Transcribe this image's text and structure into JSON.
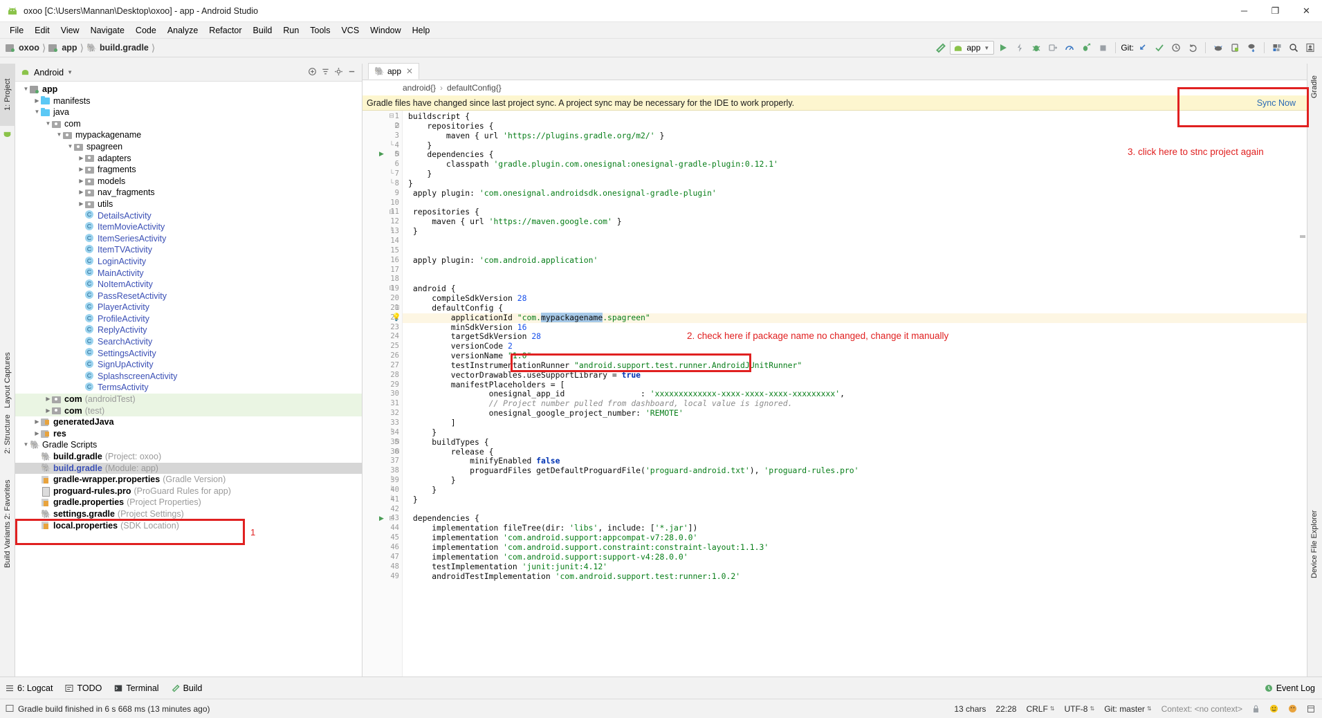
{
  "window": {
    "title": "oxoo [C:\\Users\\Mannan\\Desktop\\oxoo] - app - Android Studio",
    "minimize": "─",
    "maximize": "❐",
    "close": "✕"
  },
  "menubar": [
    "File",
    "Edit",
    "View",
    "Navigate",
    "Code",
    "Analyze",
    "Refactor",
    "Build",
    "Run",
    "Tools",
    "VCS",
    "Window",
    "Help"
  ],
  "navbar": {
    "crumbs": [
      "oxoo",
      "app",
      "build.gradle"
    ],
    "run_config": "app",
    "git_label": "Git:"
  },
  "project_panel": {
    "title": "Android",
    "tree": [
      {
        "depth": 0,
        "twisty": "down",
        "icon": "module",
        "label": "app",
        "bold": true
      },
      {
        "depth": 1,
        "twisty": "right",
        "icon": "folder",
        "label": "manifests"
      },
      {
        "depth": 1,
        "twisty": "down",
        "icon": "folder",
        "label": "java"
      },
      {
        "depth": 2,
        "twisty": "down",
        "icon": "package",
        "label": "com"
      },
      {
        "depth": 3,
        "twisty": "down",
        "icon": "package",
        "label": "mypackagename"
      },
      {
        "depth": 4,
        "twisty": "down",
        "icon": "package",
        "label": "spagreen"
      },
      {
        "depth": 5,
        "twisty": "right",
        "icon": "package",
        "label": "adapters"
      },
      {
        "depth": 5,
        "twisty": "right",
        "icon": "package",
        "label": "fragments"
      },
      {
        "depth": 5,
        "twisty": "right",
        "icon": "package",
        "label": "models"
      },
      {
        "depth": 5,
        "twisty": "right",
        "icon": "package",
        "label": "nav_fragments"
      },
      {
        "depth": 5,
        "twisty": "right",
        "icon": "package",
        "label": "utils"
      },
      {
        "depth": 5,
        "twisty": "none",
        "icon": "class",
        "label": "DetailsActivity",
        "blue": true
      },
      {
        "depth": 5,
        "twisty": "none",
        "icon": "class",
        "label": "ItemMovieActivity",
        "blue": true
      },
      {
        "depth": 5,
        "twisty": "none",
        "icon": "class",
        "label": "ItemSeriesActivity",
        "blue": true
      },
      {
        "depth": 5,
        "twisty": "none",
        "icon": "class",
        "label": "ItemTVActivity",
        "blue": true
      },
      {
        "depth": 5,
        "twisty": "none",
        "icon": "class",
        "label": "LoginActivity",
        "blue": true
      },
      {
        "depth": 5,
        "twisty": "none",
        "icon": "class",
        "label": "MainActivity",
        "blue": true
      },
      {
        "depth": 5,
        "twisty": "none",
        "icon": "class",
        "label": "NoItemActivity",
        "blue": true
      },
      {
        "depth": 5,
        "twisty": "none",
        "icon": "class",
        "label": "PassResetActivity",
        "blue": true
      },
      {
        "depth": 5,
        "twisty": "none",
        "icon": "class",
        "label": "PlayerActivity",
        "blue": true
      },
      {
        "depth": 5,
        "twisty": "none",
        "icon": "class",
        "label": "ProfileActivity",
        "blue": true
      },
      {
        "depth": 5,
        "twisty": "none",
        "icon": "class",
        "label": "ReplyActivity",
        "blue": true
      },
      {
        "depth": 5,
        "twisty": "none",
        "icon": "class",
        "label": "SearchActivity",
        "blue": true
      },
      {
        "depth": 5,
        "twisty": "none",
        "icon": "class",
        "label": "SettingsActivity",
        "blue": true
      },
      {
        "depth": 5,
        "twisty": "none",
        "icon": "class",
        "label": "SignUpActivity",
        "blue": true
      },
      {
        "depth": 5,
        "twisty": "none",
        "icon": "class",
        "label": "SplashscreenActivity",
        "blue": true
      },
      {
        "depth": 5,
        "twisty": "none",
        "icon": "class",
        "label": "TermsActivity",
        "blue": true
      },
      {
        "depth": 2,
        "twisty": "right",
        "icon": "package",
        "label": "com",
        "sub": "(androidTest)",
        "bold": true,
        "testrow": true
      },
      {
        "depth": 2,
        "twisty": "right",
        "icon": "package",
        "label": "com",
        "sub": "(test)",
        "bold": true,
        "testrow": true
      },
      {
        "depth": 1,
        "twisty": "right",
        "icon": "generated",
        "label": "generatedJava",
        "bold": true
      },
      {
        "depth": 1,
        "twisty": "right",
        "icon": "res",
        "label": "res",
        "bold": true
      },
      {
        "depth": 0,
        "twisty": "down",
        "icon": "gradle",
        "label": "Gradle Scripts",
        "bold": false
      },
      {
        "depth": 1,
        "twisty": "none",
        "icon": "gradle",
        "label": "build.gradle",
        "sub": "(Project: oxoo)",
        "bold": true
      },
      {
        "depth": 1,
        "twisty": "none",
        "icon": "gradle",
        "label": "build.gradle",
        "sub": "(Module: app)",
        "bold": true,
        "blue": true,
        "selected": true
      },
      {
        "depth": 1,
        "twisty": "none",
        "icon": "props",
        "label": "gradle-wrapper.properties",
        "sub": "(Gradle Version)",
        "bold": true
      },
      {
        "depth": 1,
        "twisty": "none",
        "icon": "doc",
        "label": "proguard-rules.pro",
        "sub": "(ProGuard Rules for app)",
        "bold": true
      },
      {
        "depth": 1,
        "twisty": "none",
        "icon": "props",
        "label": "gradle.properties",
        "sub": "(Project Properties)",
        "bold": true
      },
      {
        "depth": 1,
        "twisty": "none",
        "icon": "gradle",
        "label": "settings.gradle",
        "sub": "(Project Settings)",
        "bold": true
      },
      {
        "depth": 1,
        "twisty": "none",
        "icon": "props",
        "label": "local.properties",
        "sub": "(SDK Location)",
        "bold": true
      }
    ]
  },
  "left_rail": [
    {
      "label": "1: Project",
      "selected": true
    },
    {
      "label": "Layout Captures",
      "selected": false
    },
    {
      "label": "2: Structure",
      "selected": false
    },
    {
      "label": "2: Favorites",
      "selected": false
    },
    {
      "label": "Build Variants",
      "selected": false
    }
  ],
  "right_rail": [
    {
      "label": "Gradle"
    },
    {
      "label": "Device File Explorer"
    }
  ],
  "editor": {
    "tab_label": "app",
    "tab_close": "✕",
    "breadcrumbs": [
      "android{}",
      "defaultConfig{}"
    ],
    "notification": "Gradle files have changed since last project sync. A project sync may be necessary for the IDE to work properly.",
    "sync_now": "Sync Now",
    "lines": [
      {
        "n": 1,
        "fold": "minus",
        "text": "buildscript {"
      },
      {
        "n": 2,
        "fold": "minus2",
        "text": "    repositories {"
      },
      {
        "n": 3,
        "text": "        maven { url <s>'https://plugins.gradle.org/m2/'</s> }"
      },
      {
        "n": 4,
        "fold": "end",
        "text": "    }"
      },
      {
        "n": 5,
        "fold": "minus2",
        "run": true,
        "text": "    dependencies {"
      },
      {
        "n": 6,
        "text": "        classpath <s>'gradle.plugin.com.onesignal:onesignal-gradle-plugin:0.12.1'</s>"
      },
      {
        "n": 7,
        "fold": "end",
        "text": "    }"
      },
      {
        "n": 8,
        "fold": "end",
        "text": "}"
      },
      {
        "n": 9,
        "text": " apply plugin: <s>'com.onesignal.androidsdk.onesignal-gradle-plugin'</s>"
      },
      {
        "n": 10,
        "text": ""
      },
      {
        "n": 11,
        "fold": "minus",
        "text": " repositories {"
      },
      {
        "n": 12,
        "text": "     maven { url <s>'https://maven.google.com'</s> }"
      },
      {
        "n": 13,
        "fold": "end",
        "text": " }"
      },
      {
        "n": 14,
        "text": ""
      },
      {
        "n": 15,
        "text": ""
      },
      {
        "n": 16,
        "text": " apply plugin: <s>'com.android.application'</s>"
      },
      {
        "n": 17,
        "text": ""
      },
      {
        "n": 18,
        "text": ""
      },
      {
        "n": 19,
        "fold": "minus",
        "text": " android {"
      },
      {
        "n": 20,
        "text": "     compileSdkVersion <n>28</n>"
      },
      {
        "n": 21,
        "fold": "minus2",
        "text": "     defaultConfig {"
      },
      {
        "n": 22,
        "hl": true,
        "bulb": true,
        "text": "         applicationId <s>\"com.</s><sel>mypackagename</sel><s>.spagreen\"</s>"
      },
      {
        "n": 23,
        "text": "         minSdkVersion <n>16</n>"
      },
      {
        "n": 24,
        "text": "         targetSdkVersion <n>28</n>"
      },
      {
        "n": 25,
        "text": "         versionCode <n>2</n>"
      },
      {
        "n": 26,
        "text": "         versionName <s>\"1.0\"</s>"
      },
      {
        "n": 27,
        "text": "         testInstrumentationRunner <s>\"android.support.test.runner.AndroidJUnitRunner\"</s>"
      },
      {
        "n": 28,
        "text": "         vectorDrawables.useSupportLibrary = <k>true</k>"
      },
      {
        "n": 29,
        "text": "         manifestPlaceholders = ["
      },
      {
        "n": 30,
        "text": "                 onesignal_app_id                : <s>'xxxxxxxxxxxxx-xxxx-xxxx-xxxx-xxxxxxxxx'</s>,"
      },
      {
        "n": 31,
        "text": "                 <c>// Project number pulled from dashboard, local value is ignored.</c>"
      },
      {
        "n": 32,
        "text": "                 onesignal_google_project_number: <s>'REMOTE'</s>"
      },
      {
        "n": 33,
        "text": "         ]"
      },
      {
        "n": 34,
        "fold": "end",
        "text": "     }"
      },
      {
        "n": 35,
        "fold": "minus2",
        "text": "     buildTypes {"
      },
      {
        "n": 36,
        "fold": "minus2",
        "text": "         release {"
      },
      {
        "n": 37,
        "text": "             minifyEnabled <k>false</k>"
      },
      {
        "n": 38,
        "text": "             proguardFiles getDefaultProguardFile(<s>'proguard-android.txt'</s>), <s>'proguard-rules.pro'</s>"
      },
      {
        "n": 39,
        "fold": "end",
        "text": "         }"
      },
      {
        "n": 40,
        "fold": "end",
        "text": "     }"
      },
      {
        "n": 41,
        "fold": "end",
        "text": " }"
      },
      {
        "n": 42,
        "text": ""
      },
      {
        "n": 43,
        "fold": "minus",
        "run": true,
        "text": " dependencies {"
      },
      {
        "n": 44,
        "text": "     implementation fileTree(dir: <s>'libs'</s>, include: [<s>'*.jar'</s>])"
      },
      {
        "n": 45,
        "text": "     implementation <s>'com.android.support:appcompat-v7:28.0.0'</s>"
      },
      {
        "n": 46,
        "text": "     implementation <s>'com.android.support.constraint:constraint-layout:1.1.3'</s>"
      },
      {
        "n": 47,
        "text": "     implementation <s>'com.android.support:support-v4:28.0.0'</s>"
      },
      {
        "n": 48,
        "text": "     testImplementation <s>'junit:junit:4.12'</s>"
      },
      {
        "n": 49,
        "text": "     androidTestImplementation <s>'com.android.support.test:runner:1.0.2'</s>"
      }
    ]
  },
  "annotations": {
    "step1": "1",
    "step2": "2. check here if package name no changed, change it manually",
    "step3": "3. click here to stnc project again"
  },
  "toolwindow_bar": {
    "items": [
      {
        "label": "6: Logcat",
        "icon": "logcat-icon"
      },
      {
        "label": "TODO",
        "icon": "todo-icon"
      },
      {
        "label": "Terminal",
        "icon": "terminal-icon"
      },
      {
        "label": "Build",
        "icon": "build-icon"
      }
    ],
    "event_log": "Event Log"
  },
  "statusbar": {
    "message": "Gradle build finished in 6 s 668 ms (13 minutes ago)",
    "chars": "13 chars",
    "position": "22:28",
    "line_sep": "CRLF",
    "encoding": "UTF-8",
    "git_branch": "Git: master",
    "context": "Context: <no context>"
  },
  "colors": {
    "accent_red": "#e02020",
    "notif_yellow": "#fdf6cf",
    "link_blue": "#2a6ab5",
    "string_green": "#067d17",
    "keyword_blue": "#0033b3",
    "number_blue": "#1750eb",
    "selection_blue": "#a6c9e8",
    "test_green": "#eaf5e3"
  }
}
